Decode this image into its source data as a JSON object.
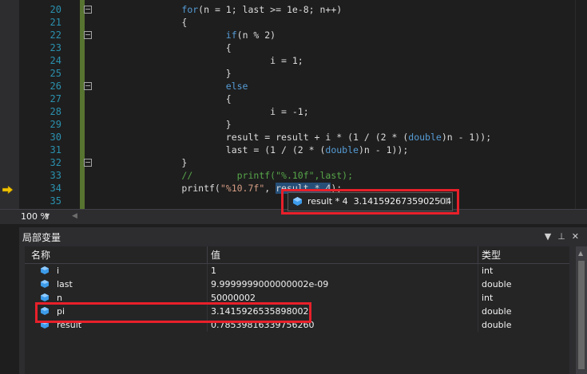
{
  "editor": {
    "lines": [
      {
        "num": "20",
        "parts": [
          {
            "t": "        "
          },
          {
            "t": "for",
            "c": "kw"
          },
          {
            "t": "(n = 1; last >= 1e-8; n++)"
          }
        ]
      },
      {
        "num": "21",
        "parts": [
          {
            "t": "        {"
          }
        ]
      },
      {
        "num": "22",
        "parts": [
          {
            "t": "                "
          },
          {
            "t": "if",
            "c": "kw"
          },
          {
            "t": "(n % 2)"
          }
        ]
      },
      {
        "num": "23",
        "parts": [
          {
            "t": "                {"
          }
        ]
      },
      {
        "num": "24",
        "parts": [
          {
            "t": "                        i = 1;"
          }
        ]
      },
      {
        "num": "25",
        "parts": [
          {
            "t": "                }"
          }
        ]
      },
      {
        "num": "26",
        "parts": [
          {
            "t": "                "
          },
          {
            "t": "else",
            "c": "kw"
          }
        ]
      },
      {
        "num": "27",
        "parts": [
          {
            "t": "                {"
          }
        ]
      },
      {
        "num": "28",
        "parts": [
          {
            "t": "                        i = -1;"
          }
        ]
      },
      {
        "num": "29",
        "parts": [
          {
            "t": "                }"
          }
        ]
      },
      {
        "num": "30",
        "parts": [
          {
            "t": "                result = result + i * (1 / (2 * ("
          },
          {
            "t": "double",
            "c": "kw"
          },
          {
            "t": ")n - 1));"
          }
        ]
      },
      {
        "num": "31",
        "parts": [
          {
            "t": "                last = (1 / (2 * ("
          },
          {
            "t": "double",
            "c": "kw"
          },
          {
            "t": ")n - 1));"
          }
        ]
      },
      {
        "num": "32",
        "parts": [
          {
            "t": "        }"
          }
        ]
      },
      {
        "num": "33",
        "parts": [
          {
            "t": "        "
          },
          {
            "t": "//        printf(\"%.10f\",last);",
            "c": "cm"
          }
        ]
      },
      {
        "num": "34",
        "parts": [
          {
            "t": "        printf("
          },
          {
            "t": "\"%10.7f\"",
            "c": "st"
          },
          {
            "t": ", "
          },
          {
            "t": "result * 4",
            "c": "sel"
          },
          {
            "t": ");"
          }
        ]
      },
      {
        "num": "35",
        "parts": [
          {
            "t": ""
          }
        ]
      }
    ],
    "fold_lines": [
      "20",
      "22",
      "26",
      "32"
    ],
    "zoom": "100 %"
  },
  "datatip": {
    "expression": "result * 4",
    "value": "3.1415926735902504"
  },
  "locals": {
    "title": "局部变量",
    "columns": {
      "name": "名称",
      "value": "值",
      "type": "类型"
    },
    "rows": [
      {
        "name": "i",
        "value": "1",
        "type": "int"
      },
      {
        "name": "last",
        "value": "9.9999999000000002e-09",
        "type": "double"
      },
      {
        "name": "n",
        "value": "50000002",
        "type": "int"
      },
      {
        "name": "pi",
        "value": "3.1415926535898002",
        "type": "double"
      },
      {
        "name": "result",
        "value": "0.78539816339756260",
        "type": "double"
      }
    ]
  },
  "colors": {
    "highlight": "#e8202a",
    "keyword": "#569cd6",
    "comment": "#57a64a",
    "string": "#d69d85",
    "line_number": "#2b91af",
    "selection": "#264f78"
  }
}
